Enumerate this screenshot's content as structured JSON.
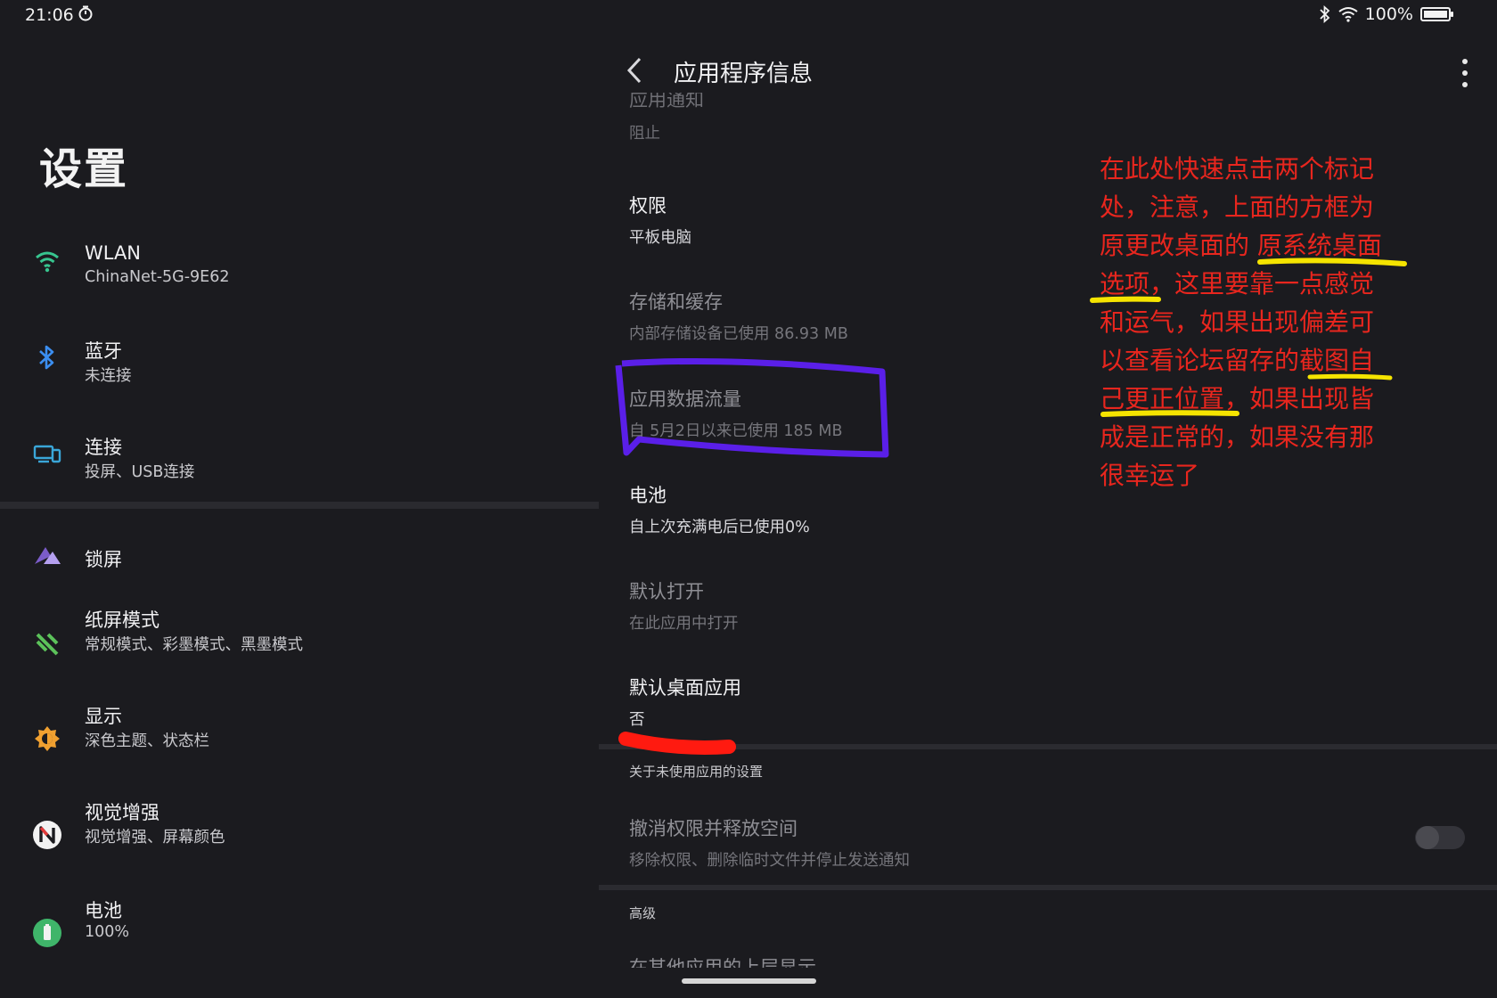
{
  "status_bar": {
    "time": "21:06",
    "battery": "100%",
    "battery_level": 1.0
  },
  "left": {
    "title": "设置",
    "items": [
      {
        "label": "WLAN",
        "sub": "ChinaNet-5G-9E62",
        "icon": "wifi-icon"
      },
      {
        "label": "蓝牙",
        "sub": "未连接",
        "icon": "bluetooth-icon"
      },
      {
        "label": "连接",
        "sub": "投屏、USB连接",
        "icon": "devices-icon"
      },
      {
        "label": "锁屏",
        "sub": "",
        "icon": "lock-screen-icon"
      },
      {
        "label": "纸屏模式",
        "sub": "常规模式、彩墨模式、黑墨模式",
        "icon": "paper-mode-icon"
      },
      {
        "label": "显示",
        "sub": "深色主题、状态栏",
        "icon": "display-icon"
      },
      {
        "label": "视觉增强",
        "sub": "视觉增强、屏幕颜色",
        "icon": "visual-enhance-icon"
      },
      {
        "label": "电池",
        "sub": "100%",
        "icon": "battery-icon"
      }
    ]
  },
  "right": {
    "title": "应用程序信息",
    "top_cut_label": "应用通知",
    "top_cut_sub": "阻止",
    "rows": [
      {
        "label": "权限",
        "sub": "平板电脑"
      },
      {
        "label": "存储和缓存",
        "sub": "内部存储设备已使用 86.93 MB"
      },
      {
        "label": "应用数据流量",
        "sub": "自 5月2日以来已使用 185 MB"
      },
      {
        "label": "电池",
        "sub": "自上次充满电后已使用0%"
      },
      {
        "label": "默认打开",
        "sub": "在此应用中打开"
      },
      {
        "label": "默认桌面应用",
        "sub": "否"
      }
    ],
    "unused_section": "关于未使用应用的设置",
    "revoke_label": "撤消权限并释放空间",
    "revoke_sub": "移除权限、删除临时文件并停止发送通知",
    "revoke_enabled": false,
    "advanced_section": "高级",
    "bottom_cut_label": "在其他应用的上层显示"
  },
  "annotation": {
    "lines": [
      "在此处快速点击两个标记",
      "处，注意，上面的方框为",
      "原更改桌面的 原系统桌面",
      "选项，这里要靠一点感觉",
      "和运气，如果出现偏差可",
      "以查看论坛留存的截图自",
      "己更正位置，如果出现皆",
      "成是正常的，如果没有那",
      "很幸运了"
    ],
    "colors": {
      "text": "#e8261e",
      "underline": "#f5e400",
      "box": "#5a1fe8",
      "mark": "#ff1a10"
    }
  }
}
